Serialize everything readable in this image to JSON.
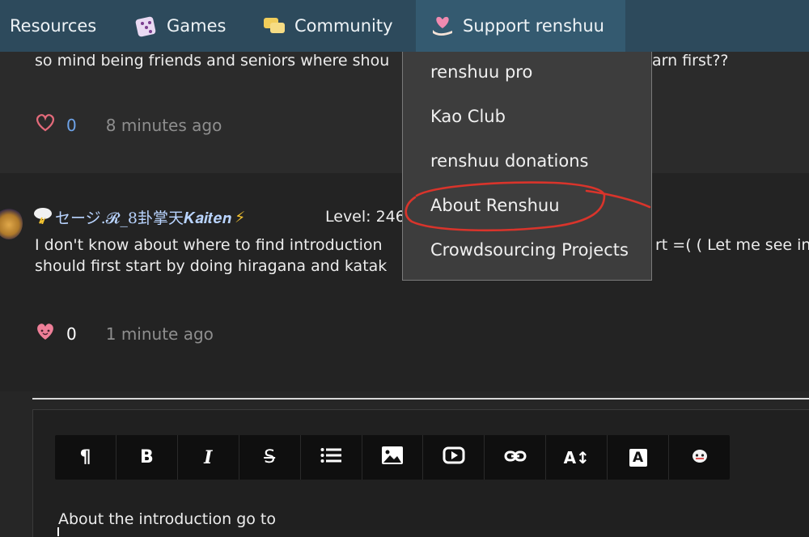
{
  "nav": {
    "items": [
      {
        "label": "Resources",
        "icon": "resources-icon"
      },
      {
        "label": "Games",
        "icon": "dice-icon"
      },
      {
        "label": "Community",
        "icon": "chat-bubbles-icon"
      },
      {
        "label": "Support renshuu",
        "icon": "heart-hand-icon"
      }
    ]
  },
  "posts": [
    {
      "text_line1": "so mind being friends and seniors where shou",
      "text_line1_right": "arn first??",
      "likes": "0",
      "time": "8 minutes ago",
      "like_icon": "heart-outline-icon"
    },
    {
      "username": "セージ.𝓡_8卦掌天𝑲𝒂𝒊𝒕𝒆𝒏",
      "level": "Level: 246",
      "text_line1": "I don't know about where to find introduction",
      "text_line1_right": "rt =( ( Let me see in",
      "text_line2": "should first start by doing hiragana and katak",
      "likes": "0",
      "time": "1 minute ago",
      "like_icon": "heart-face-icon"
    }
  ],
  "dropdown": {
    "items": [
      "renshuu pro",
      "Kao Club",
      "renshuu donations",
      "About Renshuu",
      "Crowdsourcing Projects"
    ],
    "highlight_color": "#d9342b"
  },
  "editor": {
    "toolbar": [
      {
        "label": "¶",
        "icon": "paragraph-icon"
      },
      {
        "label": "B",
        "icon": "bold-icon"
      },
      {
        "label": "I",
        "icon": "italic-icon"
      },
      {
        "label": "S",
        "icon": "strikethrough-icon"
      },
      {
        "label": "",
        "icon": "list-icon"
      },
      {
        "label": "",
        "icon": "image-icon"
      },
      {
        "label": "",
        "icon": "video-icon"
      },
      {
        "label": "",
        "icon": "link-icon"
      },
      {
        "label": "A↕",
        "icon": "font-size-icon"
      },
      {
        "label": "A",
        "icon": "font-color-icon"
      },
      {
        "label": "",
        "icon": "kao-face-icon"
      }
    ],
    "content": "About the introduction go to"
  },
  "colors": {
    "nav_bg": "#2d4a5c",
    "heart": "#e36a7a",
    "time": "#8e8e8e",
    "annotation": "#d9342b"
  }
}
